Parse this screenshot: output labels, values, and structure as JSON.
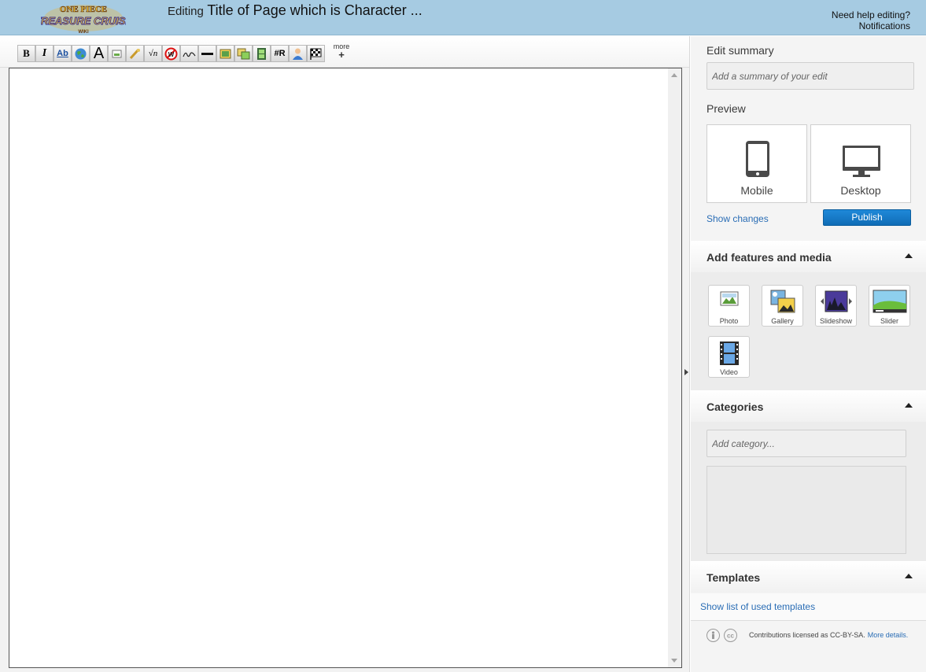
{
  "header": {
    "logo_line1": "ONE PIECE",
    "logo_line2": "TREASURE CRUISE",
    "logo_line3": "WIKI",
    "editing_label": "Editing",
    "page_title": "Title of Page which is Character ...",
    "help_link": "Need help editing?",
    "notifications_link": "Notifications"
  },
  "toolbar": {
    "buttons": [
      {
        "name": "bold",
        "glyph": "B"
      },
      {
        "name": "italic",
        "glyph": "I"
      },
      {
        "name": "internal-link",
        "glyph": "Ab"
      },
      {
        "name": "external-link",
        "glyph": ""
      },
      {
        "name": "headline",
        "glyph": "A"
      },
      {
        "name": "embedded-file",
        "glyph": ""
      },
      {
        "name": "media-file",
        "glyph": ""
      },
      {
        "name": "math",
        "glyph": "√n"
      },
      {
        "name": "ignore-wiki",
        "glyph": "W"
      },
      {
        "name": "signature",
        "glyph": ""
      },
      {
        "name": "horizontal-line",
        "glyph": ""
      },
      {
        "name": "image",
        "glyph": ""
      },
      {
        "name": "gallery",
        "glyph": ""
      },
      {
        "name": "video",
        "glyph": ""
      },
      {
        "name": "redirect",
        "glyph": "#R"
      },
      {
        "name": "user",
        "glyph": ""
      },
      {
        "name": "checkered-flag",
        "glyph": ""
      }
    ],
    "more_label": "more",
    "more_plus": "+"
  },
  "rail": {
    "edit_summary_label": "Edit summary",
    "edit_summary_placeholder": "Add a summary of your edit",
    "preview_label": "Preview",
    "mobile_label": "Mobile",
    "desktop_label": "Desktop",
    "show_changes": "Show changes",
    "publish": "Publish",
    "features_title": "Add features and media",
    "features": [
      {
        "label": "Photo"
      },
      {
        "label": "Gallery"
      },
      {
        "label": "Slideshow"
      },
      {
        "label": "Slider"
      },
      {
        "label": "Video"
      }
    ],
    "categories_title": "Categories",
    "category_placeholder": "Add category...",
    "templates_title": "Templates",
    "templates_link": "Show list of used templates",
    "license_text": "Contributions licensed as CC-BY-SA.",
    "license_link": "More details."
  },
  "colors": {
    "header_bg": "#a6cbe2",
    "publish_bg": "#1f89d9",
    "link": "#2a6db5"
  }
}
